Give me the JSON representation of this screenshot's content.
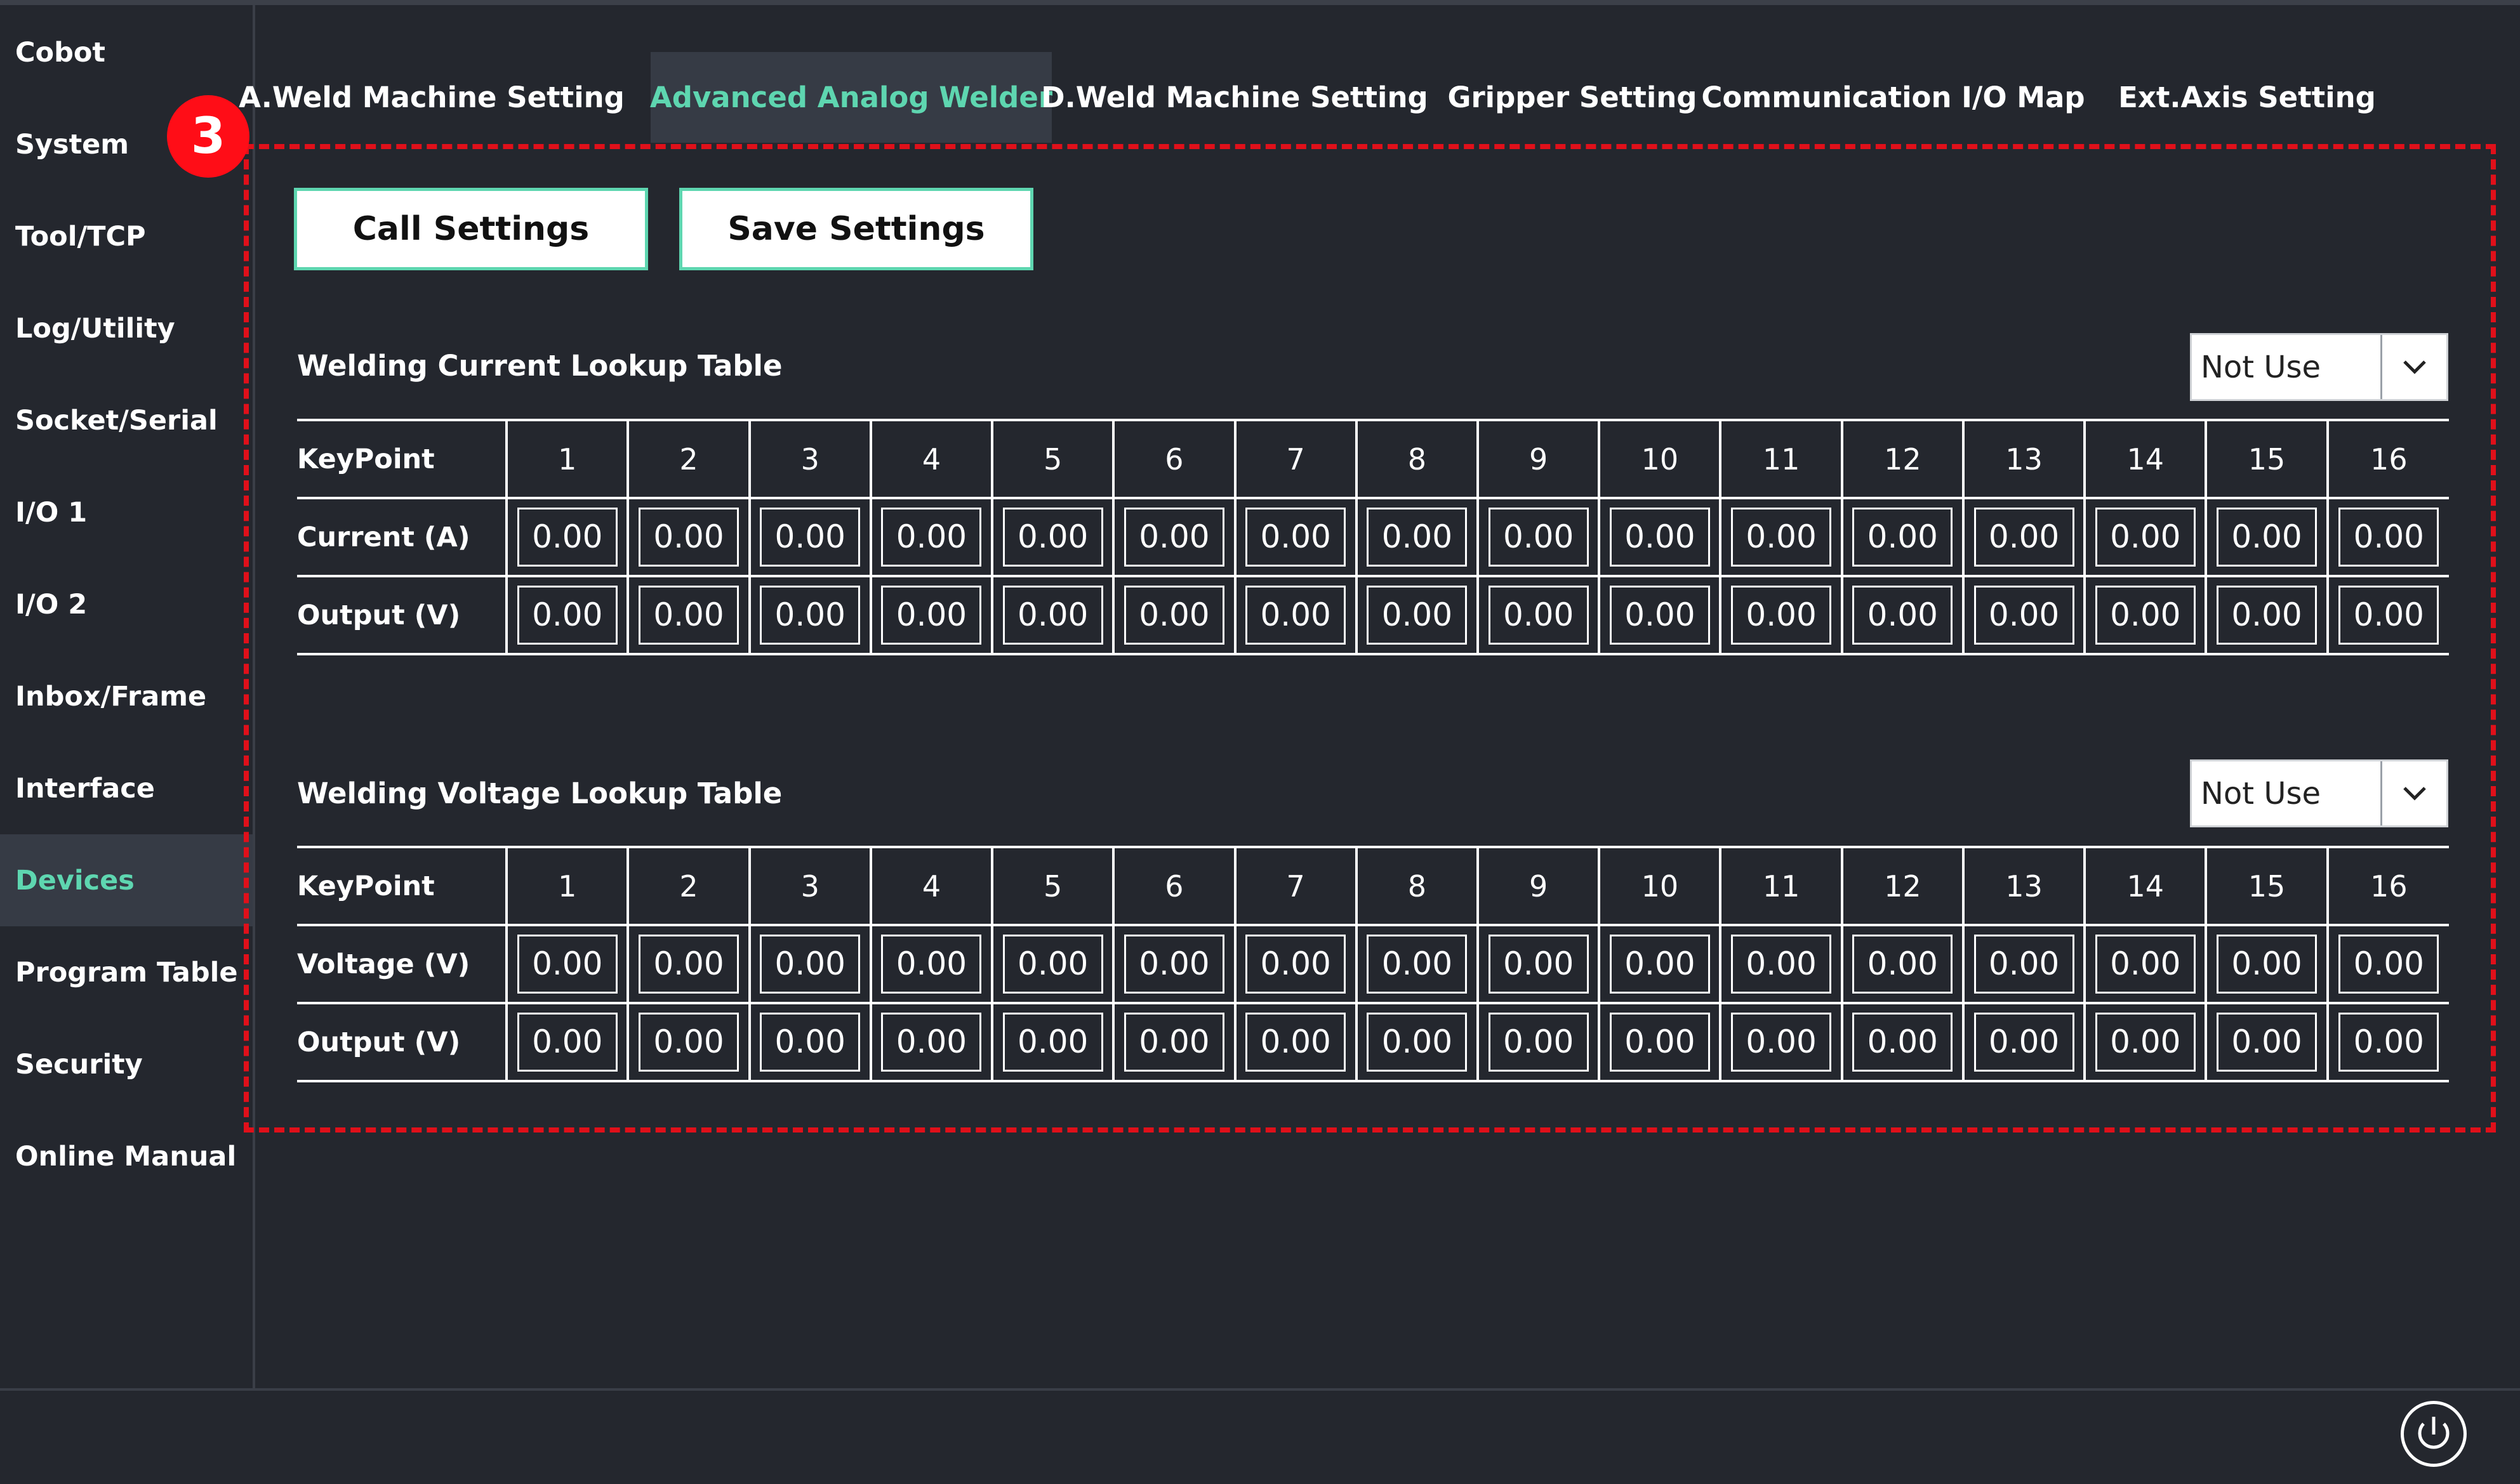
{
  "sidebar": {
    "items": [
      "Cobot",
      "System",
      "Tool/TCP",
      "Log/Utility",
      "Socket/Serial",
      "I/O 1",
      "I/O 2",
      "Inbox/Frame",
      "Interface",
      "Devices",
      "Program Table",
      "Security",
      "Online Manual"
    ],
    "active_index": 9
  },
  "tabs": [
    "A.Weld Machine Setting",
    "Advanced Analog Welder",
    "D.Weld Machine Setting",
    "Gripper Setting",
    "Communication I/O Map",
    "Ext.Axis Setting"
  ],
  "active_tab_index": 1,
  "annotation": {
    "badge": "3"
  },
  "toolbar": {
    "call_label": "Call Settings",
    "save_label": "Save Settings"
  },
  "current_table": {
    "title": "Welding Current Lookup Table",
    "mode": "Not Use",
    "keypoint_label": "KeyPoint",
    "keypoints": [
      "1",
      "2",
      "3",
      "4",
      "5",
      "6",
      "7",
      "8",
      "9",
      "10",
      "11",
      "12",
      "13",
      "14",
      "15",
      "16"
    ],
    "rows": [
      {
        "label": "Current (A)",
        "values": [
          "0.00",
          "0.00",
          "0.00",
          "0.00",
          "0.00",
          "0.00",
          "0.00",
          "0.00",
          "0.00",
          "0.00",
          "0.00",
          "0.00",
          "0.00",
          "0.00",
          "0.00",
          "0.00"
        ]
      },
      {
        "label": "Output (V)",
        "values": [
          "0.00",
          "0.00",
          "0.00",
          "0.00",
          "0.00",
          "0.00",
          "0.00",
          "0.00",
          "0.00",
          "0.00",
          "0.00",
          "0.00",
          "0.00",
          "0.00",
          "0.00",
          "0.00"
        ]
      }
    ]
  },
  "voltage_table": {
    "title": "Welding Voltage Lookup Table",
    "mode": "Not Use",
    "keypoint_label": "KeyPoint",
    "keypoints": [
      "1",
      "2",
      "3",
      "4",
      "5",
      "6",
      "7",
      "8",
      "9",
      "10",
      "11",
      "12",
      "13",
      "14",
      "15",
      "16"
    ],
    "rows": [
      {
        "label": "Voltage (V)",
        "values": [
          "0.00",
          "0.00",
          "0.00",
          "0.00",
          "0.00",
          "0.00",
          "0.00",
          "0.00",
          "0.00",
          "0.00",
          "0.00",
          "0.00",
          "0.00",
          "0.00",
          "0.00",
          "0.00"
        ]
      },
      {
        "label": "Output (V)",
        "values": [
          "0.00",
          "0.00",
          "0.00",
          "0.00",
          "0.00",
          "0.00",
          "0.00",
          "0.00",
          "0.00",
          "0.00",
          "0.00",
          "0.00",
          "0.00",
          "0.00",
          "0.00",
          "0.00"
        ]
      }
    ]
  },
  "colors": {
    "accent": "#5ed6b0",
    "background": "#24272e",
    "annotation": "#e0101a"
  },
  "icons": {
    "dropdown": "chevron-down-icon",
    "power": "power-icon"
  }
}
